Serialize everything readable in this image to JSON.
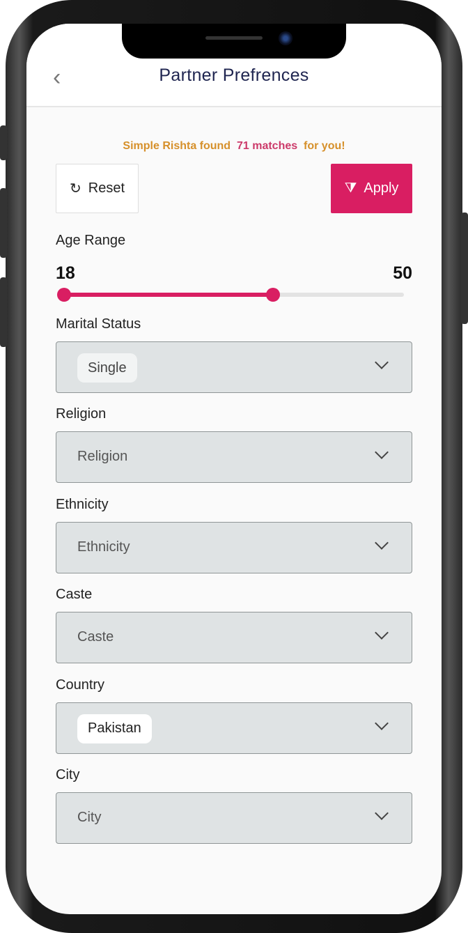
{
  "header": {
    "title": "Partner Prefrences",
    "back_icon": "chevron-left-icon"
  },
  "banner": {
    "prefix": "Simple Rishta found",
    "count": "71 matches",
    "suffix": "for you!"
  },
  "buttons": {
    "reset": "Reset",
    "apply": "Apply",
    "reset_icon": "refresh-icon",
    "apply_icon": "filter-check-icon"
  },
  "age": {
    "label": "Age Range",
    "min_label": "18",
    "max_label": "50",
    "lower_fraction": 0.0,
    "upper_fraction": 0.615
  },
  "colors": {
    "accent": "#d91e62",
    "banner": "#d6902a"
  },
  "fields": [
    {
      "label": "Marital Status",
      "value": "Single",
      "placeholder": ""
    },
    {
      "label": "Religion",
      "value": "",
      "placeholder": "Religion"
    },
    {
      "label": "Ethnicity",
      "value": "",
      "placeholder": "Ethnicity"
    },
    {
      "label": "Caste",
      "value": "",
      "placeholder": "Caste"
    },
    {
      "label": "Country",
      "value": "Pakistan",
      "placeholder": ""
    },
    {
      "label": "City",
      "value": "",
      "placeholder": "City"
    }
  ]
}
